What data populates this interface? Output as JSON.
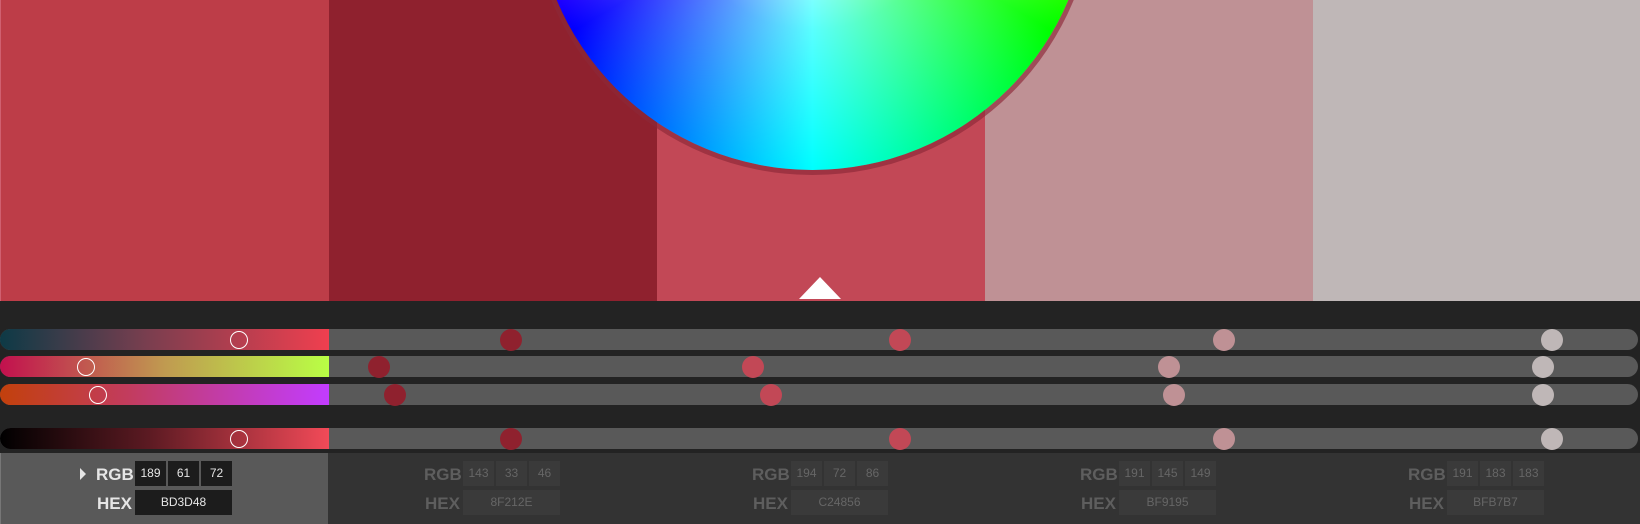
{
  "colors": [
    {
      "hex": "#BD3D48",
      "rgb": [
        "189",
        "61",
        "72"
      ],
      "hex_label": "BD3D48",
      "selected": true
    },
    {
      "hex": "#8F212E",
      "rgb": [
        "143",
        "33",
        "46"
      ],
      "hex_label": "8F212E",
      "selected": false
    },
    {
      "hex": "#C24856",
      "rgb": [
        "194",
        "72",
        "86"
      ],
      "hex_label": "C24856",
      "selected": false
    },
    {
      "hex": "#BF9195",
      "rgb": [
        "191",
        "145",
        "149"
      ],
      "hex_label": "BF9195",
      "selected": false
    },
    {
      "hex": "#BFB7B7",
      "rgb": [
        "191",
        "183",
        "183"
      ],
      "hex_label": "BFB7B7",
      "selected": false
    }
  ],
  "labels": {
    "rgb": "RGB",
    "hex": "HEX"
  },
  "slider_gradients": [
    "linear-gradient(90deg,#0d3a46,#7a3e4f 45%,#f03f4f)",
    "linear-gradient(90deg,#c2104e,#c09a50 50%,#b9ff45)",
    "linear-gradient(90deg,#c2400c,#c23c60 40%,#c23cff)",
    "linear-gradient(90deg,#000000,#5b1a22 45%,#f24a58)"
  ]
}
